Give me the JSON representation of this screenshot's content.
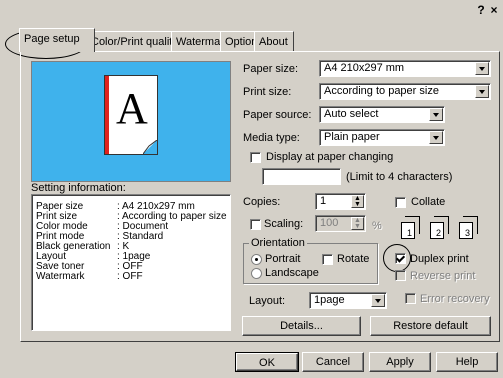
{
  "titlebar": {
    "help_label": "?",
    "close_label": "×"
  },
  "tabs": [
    {
      "label": "Page setup"
    },
    {
      "label": "Color/Print quality"
    },
    {
      "label": "Watermark"
    },
    {
      "label": "Options"
    },
    {
      "label": "About"
    }
  ],
  "preview": {
    "letter": "A"
  },
  "setting_info": {
    "label": "Setting information:",
    "rows": [
      {
        "name": "Paper size",
        "value": ": A4 210x297 mm"
      },
      {
        "name": "Print size",
        "value": ": According to paper size"
      },
      {
        "name": "Color mode",
        "value": ": Document"
      },
      {
        "name": "Print mode",
        "value": ": Standard"
      },
      {
        "name": "Black generation",
        "value": ": K"
      },
      {
        "name": "Layout",
        "value": ": 1page"
      },
      {
        "name": "Save toner",
        "value": ": OFF"
      },
      {
        "name": "Watermark",
        "value": ": OFF"
      }
    ]
  },
  "paper_size": {
    "label": "Paper size:",
    "value": "A4 210x297 mm"
  },
  "print_size": {
    "label": "Print size:",
    "value": "According to paper size"
  },
  "paper_source": {
    "label": "Paper source:",
    "value": "Auto select"
  },
  "media_type": {
    "label": "Media type:",
    "value": "Plain paper"
  },
  "display_change": {
    "label": "Display at paper changing",
    "checked": false
  },
  "limit_note": "(Limit to 4 characters)",
  "copies": {
    "label": "Copies:",
    "value": "1"
  },
  "collate": {
    "label": "Collate",
    "checked": false
  },
  "scaling": {
    "label": "Scaling:",
    "value": "100",
    "unit": "%"
  },
  "collate_pages": [
    "1",
    "2",
    "3"
  ],
  "orientation": {
    "label": "Orientation",
    "portrait": "Portrait",
    "landscape": "Landscape",
    "rotate": "Rotate",
    "selected": "Portrait"
  },
  "duplex": {
    "label": "Duplex print",
    "checked": true
  },
  "reverse": {
    "label": "Reverse print"
  },
  "layout": {
    "label": "Layout:",
    "value": "1page"
  },
  "error_recovery": {
    "label": "Error recovery"
  },
  "buttons": {
    "details": "Details...",
    "restore": "Restore default",
    "ok": "OK",
    "cancel": "Cancel",
    "apply": "Apply",
    "help": "Help"
  }
}
